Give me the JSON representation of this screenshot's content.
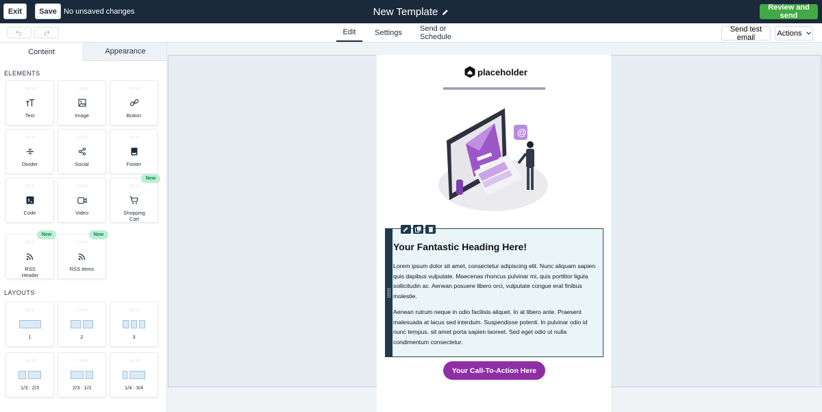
{
  "topbar": {
    "exit_label": "Exit",
    "save_label": "Save",
    "status_text": "No unsaved changes",
    "title": "New Template",
    "review_label": "Review and send"
  },
  "toolbar": {
    "tabs": [
      "Edit",
      "Settings",
      "Send or Schedule"
    ],
    "active_tab": "Edit",
    "send_test_label": "Send test email",
    "actions_label": "Actions"
  },
  "sidebar": {
    "tabs": [
      "Content",
      "Appearance"
    ],
    "active_tab": "Content",
    "elements_heading": "ELEMENTS",
    "elements": [
      {
        "label": "Text",
        "icon": "text-size-icon"
      },
      {
        "label": "Image",
        "icon": "image-icon"
      },
      {
        "label": "Button",
        "icon": "link-icon"
      },
      {
        "label": "Divider",
        "icon": "divider-icon"
      },
      {
        "label": "Social",
        "icon": "share-icon"
      },
      {
        "label": "Footer",
        "icon": "footer-icon"
      },
      {
        "label": "Code",
        "icon": "terminal-icon"
      },
      {
        "label": "Video",
        "icon": "video-icon"
      },
      {
        "label": "Shopping Cart",
        "icon": "cart-icon",
        "badge": "New"
      },
      {
        "label": "RSS Header",
        "icon": "rss-icon",
        "badge": "New"
      },
      {
        "label": "RSS Items",
        "icon": "rss-icon",
        "badge": "New"
      }
    ],
    "layouts_heading": "LAYOUTS",
    "layouts": [
      "1",
      "2",
      "3",
      "1/3 : 2/3",
      "2/3 : 1/3",
      "1/4 : 3/4"
    ]
  },
  "email": {
    "logo_text": "placeholder",
    "heading": "Your Fantastic Heading Here!",
    "paragraph1": "Lorem ipsum dolor sit amet, consectetur adipiscing elit. Nunc aliquam sapien quis dapibus vulputate. Maecenas rhoncus pulvinar mi, quis porttitor ligula sollicitudin ac. Aenean posuere libero orci, vulputate congue erat finibus molestie.",
    "paragraph2": "Aenean rutrum neque in odio facilisis aliquet. In at libero ante. Praesent malesuada at lacus sed interdum. Suspendisse potenti. In pulvinar odio id nunc tempus, sit amet porta sapien laoreet. Sed eget odio ut nulla condimentum consectetur.",
    "cta_label": "Your Call-To-Action Here",
    "illustration_icon": "email-illustration",
    "block_tools": [
      "pencil-icon",
      "copy-icon",
      "trash-icon"
    ]
  },
  "colors": {
    "topbar_bg": "#1b2a3b",
    "review_green": "#42a944",
    "cta_purple": "#8e2fa6",
    "badge_bg": "#b9f0d3",
    "badge_text": "#16804a",
    "selection_bg": "#e9f5f7"
  }
}
